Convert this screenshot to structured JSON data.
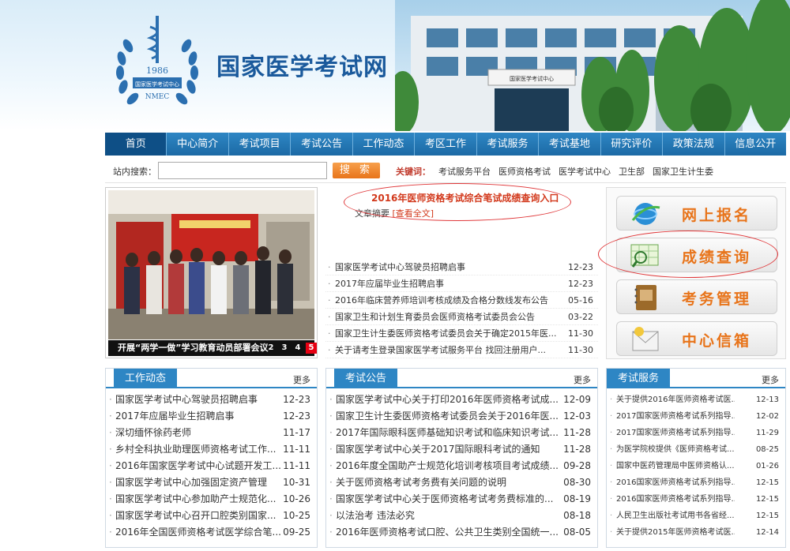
{
  "header": {
    "site_title": "国家医学考试网",
    "logo_year": "1986",
    "logo_org": "国家医学考试中心",
    "logo_abbr": "NMEC",
    "building_sign": "国家医学考试中心"
  },
  "nav": [
    "首页",
    "中心简介",
    "考试项目",
    "考试公告",
    "工作动态",
    "考区工作",
    "考试服务",
    "考试基地",
    "研究评价",
    "政策法规",
    "信息公开"
  ],
  "search": {
    "label": "站内搜索：",
    "value": "",
    "button": "搜 索",
    "keywords_label": "关键词：",
    "keywords": [
      "考试服务平台",
      "医师资格考试",
      "医学考试中心",
      "卫生部",
      "国家卫生计生委"
    ]
  },
  "slideshow": {
    "caption": "开展“两学一做”学习教育动员部署会议",
    "pages": [
      "2",
      "3",
      "4",
      "5"
    ],
    "active_page": "5"
  },
  "featured": {
    "headline": "2016年医师资格考试综合笔试成绩查询入口",
    "summary_label": "文章摘要",
    "more": "[查看全文]"
  },
  "news": [
    {
      "title": "国家医学考试中心驾驶员招聘启事",
      "date": "12-23"
    },
    {
      "title": "2017年应届毕业生招聘启事",
      "date": "12-23"
    },
    {
      "title": "2016年临床营养师培训考核成绩及合格分数线发布公告",
      "date": "05-16"
    },
    {
      "title": "国家卫生和计划生育委员会医师资格考试委员会公告",
      "date": "03-22"
    },
    {
      "title": "国家卫生计生委医师资格考试委员会关于确定2015年医...",
      "date": "11-30"
    },
    {
      "title": "关于请考生登录国家医学考试服务平台 找回注册用户...",
      "date": "11-30"
    }
  ],
  "quick_links": [
    "网上报名",
    "成绩查询",
    "考务管理",
    "中心信箱"
  ],
  "panels": {
    "work": {
      "title": "工作动态",
      "more": "更多",
      "items": [
        {
          "title": "国家医学考试中心驾驶员招聘启事",
          "date": "12-23"
        },
        {
          "title": "2017年应届毕业生招聘启事",
          "date": "12-23"
        },
        {
          "title": "深切缅怀徐药老师",
          "date": "11-17"
        },
        {
          "title": "乡村全科执业助理医师资格考试工作...",
          "date": "11-11"
        },
        {
          "title": "2016年国家医学考试中心试题开发工...",
          "date": "11-11"
        },
        {
          "title": "国家医学考试中心加强固定资产管理",
          "date": "10-31"
        },
        {
          "title": "国家医学考试中心参加助产士规范化...",
          "date": "10-26"
        },
        {
          "title": "国家医学考试中心召开口腔类别国家...",
          "date": "10-25"
        },
        {
          "title": "2016年全国医师资格考试医学综合笔...",
          "date": "09-25"
        }
      ]
    },
    "announce": {
      "title": "考试公告",
      "more": "更多",
      "items": [
        {
          "title": "国家医学考试中心关于打印2016年医师资格考试成...",
          "date": "12-09"
        },
        {
          "title": "国家卫生计生委医师资格考试委员会关于2016年医...",
          "date": "12-03"
        },
        {
          "title": "2017年国际眼科医师基础知识考试和临床知识考试...",
          "date": "11-28"
        },
        {
          "title": "国家医学考试中心关于2017国际眼科考试的通知",
          "date": "11-28"
        },
        {
          "title": "2016年度全国助产士规范化培训考核项目考试成绩...",
          "date": "09-28"
        },
        {
          "title": "关于医师资格考试考务费有关问题的说明",
          "date": "08-30"
        },
        {
          "title": "国家医学考试中心关于医师资格考试考务费标准的...",
          "date": "08-19"
        },
        {
          "title": "以法治考  违法必究",
          "date": "08-18"
        },
        {
          "title": "2016年医师资格考试口腔、公共卫生类别全国统一...",
          "date": "08-05"
        }
      ]
    },
    "service": {
      "title": "考试服务",
      "more": "更多",
      "items": [
        {
          "title": "关于提供2016年医师资格考试医...",
          "date": "12-13"
        },
        {
          "title": "2017国家医师资格考试系列指导...",
          "date": "12-02"
        },
        {
          "title": "2017国家医师资格考试系列指导...",
          "date": "11-29"
        },
        {
          "title": "为医学院校提供《医师资格考试...",
          "date": "08-25"
        },
        {
          "title": "国家中医药管理局中医师资格认...",
          "date": "01-26"
        },
        {
          "title": "2016国家医师资格考试系列指导...",
          "date": "12-15"
        },
        {
          "title": "2016国家医师资格考试系列指导...",
          "date": "12-15"
        },
        {
          "title": "人民卫生出版社考试用书各省经...",
          "date": "12-15"
        },
        {
          "title": "关于提供2015年医师资格考试医...",
          "date": "12-14"
        }
      ]
    }
  },
  "colors": {
    "nav_bg": "#1c6aa5",
    "accent_orange": "#e8741a",
    "headline_red": "#d2381b",
    "annotation_red": "#e0393b"
  }
}
